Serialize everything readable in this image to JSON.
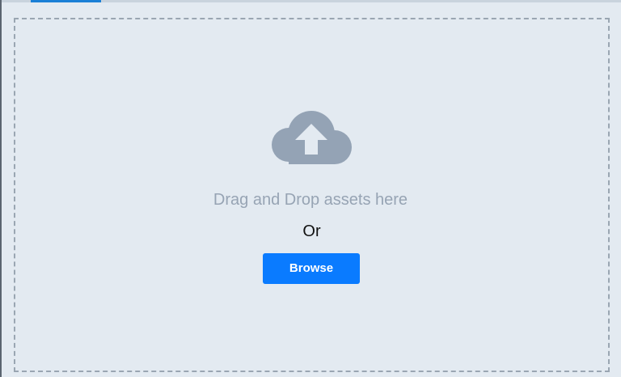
{
  "uploader": {
    "icon": "cloud-upload-icon",
    "drop_text": "Drag and Drop assets here",
    "or_text": "Or",
    "browse_label": "Browse"
  },
  "colors": {
    "background": "#e3eaf1",
    "dropzone_border": "#9aa6b2",
    "icon": "#94a3b5",
    "hint_text": "#97a4b4",
    "primary_button": "#0a7bff",
    "active_tab_indicator": "#1a7fd6"
  }
}
